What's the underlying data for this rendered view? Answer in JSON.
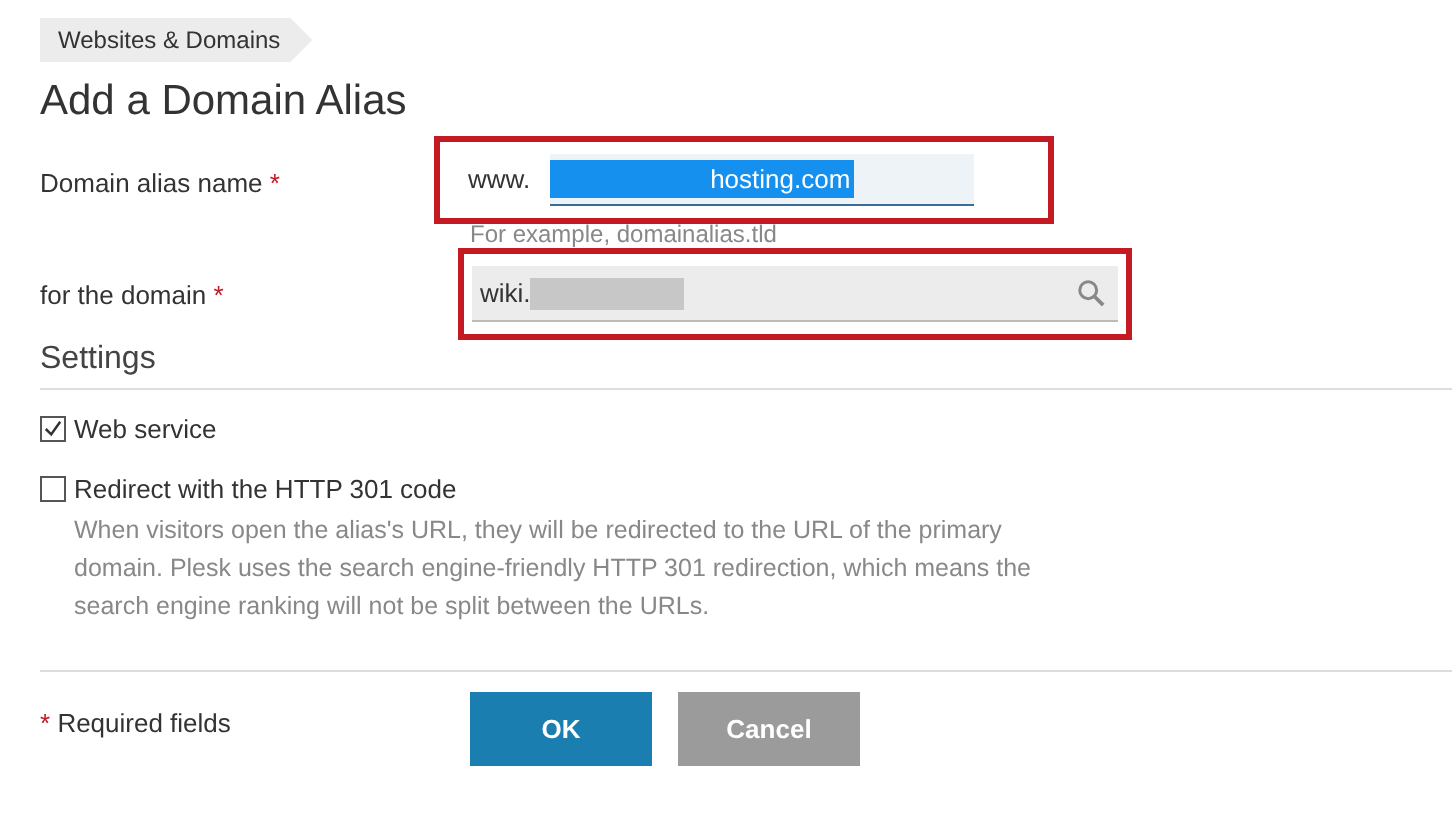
{
  "breadcrumb": "Websites & Domains",
  "title": "Add a Domain Alias",
  "fields": [
    {
      "label": "Domain alias name",
      "required_mark": "*",
      "kind": "prefixed",
      "prefix": "www.",
      "value": "hosting.com",
      "selected": true,
      "highlighted": true,
      "hint": "For example, domainalias.tld"
    },
    {
      "label": "for the domain",
      "required_mark": "*",
      "kind": "search",
      "value": "wiki.",
      "redacted": true,
      "highlighted": true
    }
  ],
  "settings": {
    "heading": "Settings",
    "options": [
      {
        "label": "Web service",
        "checked": true
      },
      {
        "label": "Redirect with the HTTP 301 code",
        "checked": false,
        "description": "When visitors open the alias's URL, they will be redirected to the URL of the primary domain. Plesk uses the search engine-friendly HTTP 301 redirection, which means the search engine ranking will not be split between the URLs."
      }
    ]
  },
  "footer": {
    "required_mark": "*",
    "required_note": "Required fields",
    "buttons": [
      {
        "label": "OK",
        "kind": "primary"
      },
      {
        "label": "Cancel",
        "kind": "secondary"
      }
    ]
  }
}
